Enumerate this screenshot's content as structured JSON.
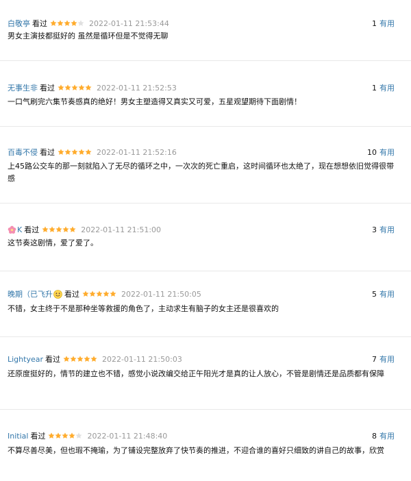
{
  "reviews": [
    {
      "author": "白敬亭",
      "watched": "看过",
      "rating": 4,
      "time": "2022-01-11 21:53:44",
      "useful_count": "1",
      "useful_label": "有用",
      "content": "男女主演技都挺好的 虽然是循环但是不觉得无聊"
    },
    {
      "author": "无事生非",
      "watched": "看过",
      "rating": 5,
      "time": "2022-01-11 21:52:53",
      "useful_count": "1",
      "useful_label": "有用",
      "content": "一口气刷完六集节奏感真的绝好！男女主塑造得又真实又可爱，五星观望期待下面剧情！"
    },
    {
      "author": "百毒不侵",
      "watched": "看过",
      "rating": 5,
      "time": "2022-01-11 21:52:16",
      "useful_count": "10",
      "useful_label": "有用",
      "content": "上45路公交车的那一刻就陷入了无尽的循环之中，一次次的死亡重启，这时间循环也太绝了，现在想想依旧觉得很带感"
    },
    {
      "author": "K",
      "author_icon": "cherry-blossom-icon",
      "watched": "看过",
      "rating": 5,
      "time": "2022-01-11 21:51:00",
      "useful_count": "3",
      "useful_label": "有用",
      "content": "这节奏这剧情，爱了爱了。"
    },
    {
      "author": "晚期（已飞升",
      "author_icon": "smiling-face-icon",
      "watched": "看过",
      "rating": 5,
      "time": "2022-01-11 21:50:05",
      "useful_count": "5",
      "useful_label": "有用",
      "content": "不错，女主终于不是那种坐等救援的角色了，主动求生有脑子的女主还是很喜欢的"
    },
    {
      "author": "Lightyear",
      "watched": "看过",
      "rating": 5,
      "time": "2022-01-11 21:50:03",
      "useful_count": "7",
      "useful_label": "有用",
      "content": "还原度挺好的，情节的建立也不错，感觉小说改编交给正午阳光才是真的让人放心，不管是剧情还是品质都有保障"
    },
    {
      "author": "Initial",
      "watched": "看过",
      "rating": 4,
      "time": "2022-01-11 21:48:40",
      "useful_count": "8",
      "useful_label": "有用",
      "content": "不算尽善尽美，但也瑕不掩瑜，为了铺设完整放弃了快节奏的推进，不迎合谁的喜好只细致的讲自己的故事，欣赏"
    }
  ],
  "colors": {
    "link": "#3377aa",
    "star_on": "#ffac2d",
    "star_off": "#e0e0e0",
    "time": "#999999",
    "divider": "#e8e8e8"
  }
}
